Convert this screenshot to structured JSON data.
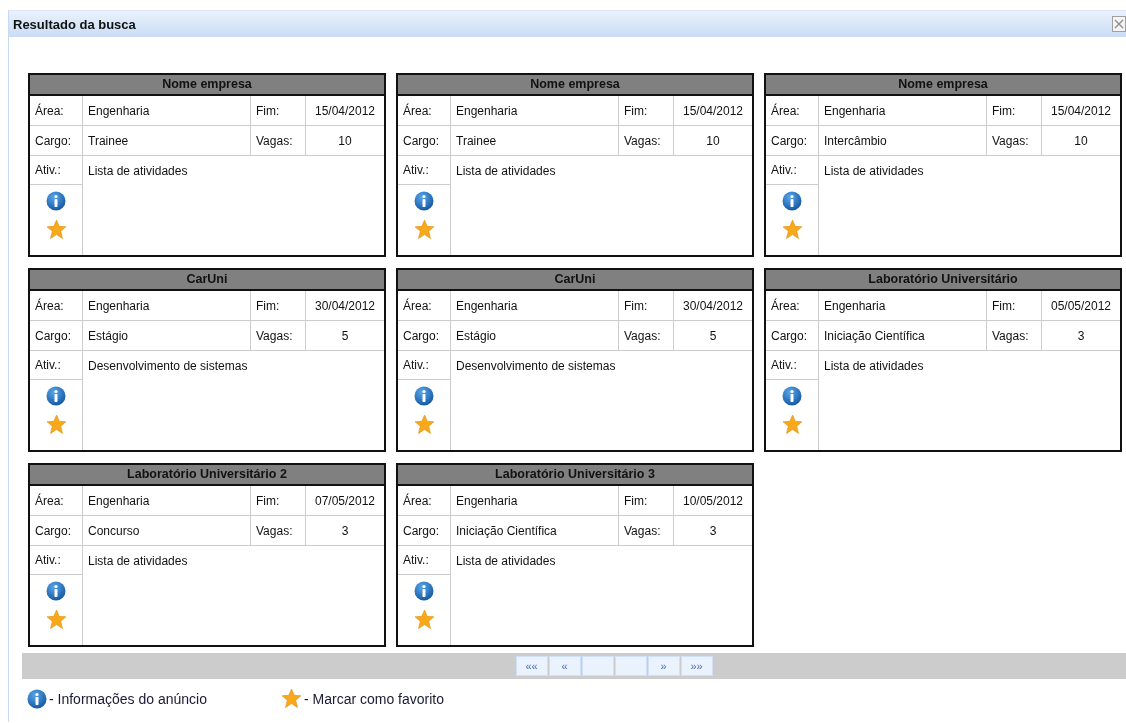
{
  "window": {
    "title": "Resultado da busca"
  },
  "cards": [
    {
      "company": "Nome empresa",
      "area_label": "Área:",
      "area": "Engenharia",
      "end_label": "Fim:",
      "end": "15/04/2012",
      "role_label": "Cargo:",
      "role": "Trainee",
      "openings_label": "Vagas:",
      "openings": "10",
      "activities_label": "Ativ.:",
      "activities": "Lista de atividades"
    },
    {
      "company": "Nome empresa",
      "area_label": "Área:",
      "area": "Engenharia",
      "end_label": "Fim:",
      "end": "15/04/2012",
      "role_label": "Cargo:",
      "role": "Trainee",
      "openings_label": "Vagas:",
      "openings": "10",
      "activities_label": "Ativ.:",
      "activities": "Lista de atividades"
    },
    {
      "company": "Nome empresa",
      "area_label": "Área:",
      "area": "Engenharia",
      "end_label": "Fim:",
      "end": "15/04/2012",
      "role_label": "Cargo:",
      "role": "Intercâmbio",
      "openings_label": "Vagas:",
      "openings": "10",
      "activities_label": "Ativ.:",
      "activities": "Lista de atividades"
    },
    {
      "company": "CarUni",
      "area_label": "Área:",
      "area": "Engenharia",
      "end_label": "Fim:",
      "end": "30/04/2012",
      "role_label": "Cargo:",
      "role": "Estágio",
      "openings_label": "Vagas:",
      "openings": "5",
      "activities_label": "Ativ.:",
      "activities": "Desenvolvimento de sistemas"
    },
    {
      "company": "CarUni",
      "area_label": "Área:",
      "area": "Engenharia",
      "end_label": "Fim:",
      "end": "30/04/2012",
      "role_label": "Cargo:",
      "role": "Estágio",
      "openings_label": "Vagas:",
      "openings": "5",
      "activities_label": "Ativ.:",
      "activities": "Desenvolvimento de sistemas"
    },
    {
      "company": "Laboratório Universitário",
      "area_label": "Área:",
      "area": "Engenharia",
      "end_label": "Fim:",
      "end": "05/05/2012",
      "role_label": "Cargo:",
      "role": "Iniciação Científica",
      "openings_label": "Vagas:",
      "openings": "3",
      "activities_label": "Ativ.:",
      "activities": "Lista de atividades"
    },
    {
      "company": "Laboratório Universitário 2",
      "area_label": "Área:",
      "area": "Engenharia",
      "end_label": "Fim:",
      "end": "07/05/2012",
      "role_label": "Cargo:",
      "role": "Concurso",
      "openings_label": "Vagas:",
      "openings": "3",
      "activities_label": "Ativ.:",
      "activities": "Lista de atividades"
    },
    {
      "company": "Laboratório Universitário 3",
      "area_label": "Área:",
      "area": "Engenharia",
      "end_label": "Fim:",
      "end": "10/05/2012",
      "role_label": "Cargo:",
      "role": "Iniciação Científica",
      "openings_label": "Vagas:",
      "openings": "3",
      "activities_label": "Ativ.:",
      "activities": "Lista de atividades"
    }
  ],
  "pager": {
    "back": [
      "««",
      "«"
    ],
    "forward": [
      "»",
      "»»"
    ]
  },
  "legend": [
    {
      "kind": "info",
      "text": "- Informações do anúncio"
    },
    {
      "kind": "favorite",
      "text": "- Marcar como favorito"
    }
  ]
}
